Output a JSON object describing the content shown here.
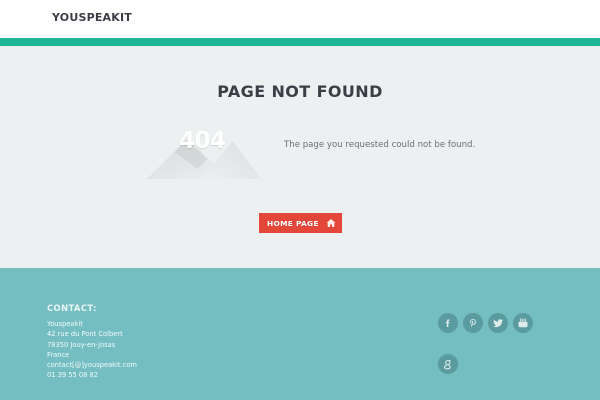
{
  "header": {
    "logo": "YOUSPEAKIT"
  },
  "colors": {
    "accent": "#1fb597",
    "button": "#e2473a",
    "footer": "#74bdc1",
    "social_bg": "#5a9b9f"
  },
  "main": {
    "title": "PAGE NOT FOUND",
    "error_code": "404",
    "message": "The page you requested could not be found.",
    "home_button": {
      "label": "HOME PAGE",
      "icon": "home-icon"
    }
  },
  "footer": {
    "contact_title": "CONTACT:",
    "lines": [
      "Youspeakit",
      "42 rue du Pont Colbert",
      "78350 Jouy-en-Josas",
      "France",
      "contact[@]youspeakit.com",
      "01 39 55 08 82"
    ],
    "social": [
      {
        "icon": "facebook-icon"
      },
      {
        "icon": "pinterest-icon"
      },
      {
        "icon": "twitter-icon"
      },
      {
        "icon": "youtube-icon"
      },
      {
        "icon": "google-plus-icon"
      }
    ]
  }
}
